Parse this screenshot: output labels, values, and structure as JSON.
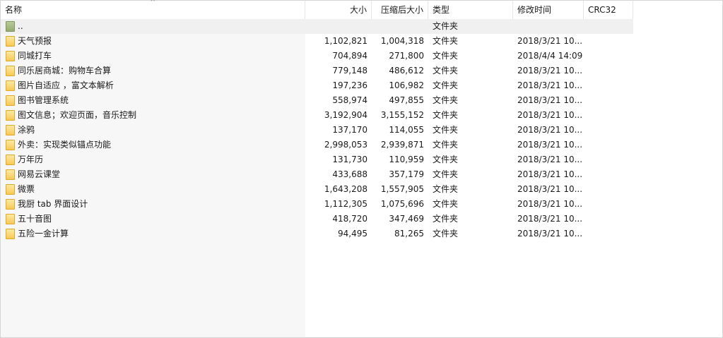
{
  "columns": {
    "name": "名称",
    "size": "大小",
    "packed": "压缩后大小",
    "type": "类型",
    "modified": "修改时间",
    "crc": "CRC32"
  },
  "sort_indicator": "^",
  "parent_row": {
    "name": "..",
    "type": "文件夹"
  },
  "rows": [
    {
      "name": "天气预报",
      "size": "1,102,821",
      "packed": "1,004,318",
      "type": "文件夹",
      "modified": "2018/3/21 10..."
    },
    {
      "name": "同城打车",
      "size": "704,894",
      "packed": "271,800",
      "type": "文件夹",
      "modified": "2018/4/4 14:09"
    },
    {
      "name": "同乐居商城：购物车合算",
      "size": "779,148",
      "packed": "486,612",
      "type": "文件夹",
      "modified": "2018/3/21 10..."
    },
    {
      "name": "图片自适应 ，富文本解析",
      "size": "197,236",
      "packed": "106,982",
      "type": "文件夹",
      "modified": "2018/3/21 10..."
    },
    {
      "name": "图书管理系统",
      "size": "558,974",
      "packed": "497,855",
      "type": "文件夹",
      "modified": "2018/3/21 10..."
    },
    {
      "name": "图文信息；欢迎页面，音乐控制",
      "size": "3,192,904",
      "packed": "3,155,152",
      "type": "文件夹",
      "modified": "2018/3/21 10..."
    },
    {
      "name": "涂鸦",
      "size": "137,170",
      "packed": "114,055",
      "type": "文件夹",
      "modified": "2018/3/21 10..."
    },
    {
      "name": "外卖：实现类似锚点功能",
      "size": "2,998,053",
      "packed": "2,939,871",
      "type": "文件夹",
      "modified": "2018/3/21 10..."
    },
    {
      "name": "万年历",
      "size": "131,730",
      "packed": "110,959",
      "type": "文件夹",
      "modified": "2018/3/21 10..."
    },
    {
      "name": "网易云课堂",
      "size": "433,688",
      "packed": "357,179",
      "type": "文件夹",
      "modified": "2018/3/21 10..."
    },
    {
      "name": "微票",
      "size": "1,643,208",
      "packed": "1,557,905",
      "type": "文件夹",
      "modified": "2018/3/21 10..."
    },
    {
      "name": "我厨 tab 界面设计",
      "size": "1,112,305",
      "packed": "1,075,696",
      "type": "文件夹",
      "modified": "2018/3/21 10..."
    },
    {
      "name": "五十音图",
      "size": "418,720",
      "packed": "347,469",
      "type": "文件夹",
      "modified": "2018/3/21 10..."
    },
    {
      "name": "五险一金计算",
      "size": "94,495",
      "packed": "81,265",
      "type": "文件夹",
      "modified": "2018/3/21 10..."
    }
  ]
}
